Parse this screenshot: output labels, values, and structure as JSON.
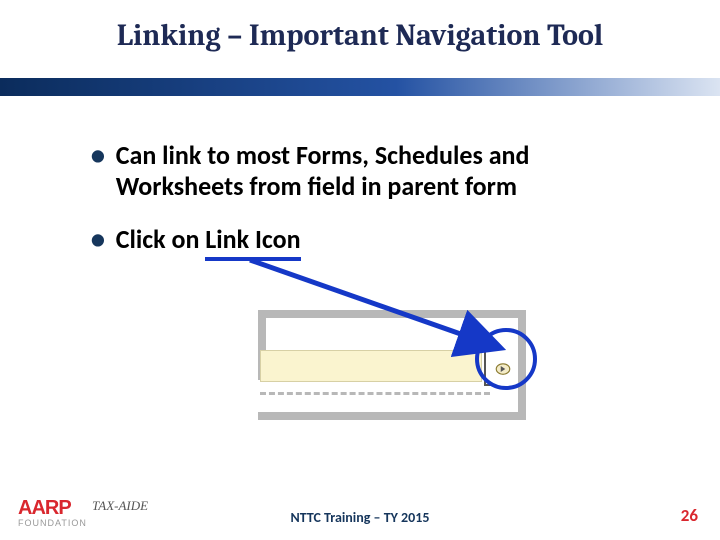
{
  "title": "Linking – Important Navigation Tool",
  "bullets": [
    "Can link to most Forms, Schedules and Worksheets from field in parent form",
    "Click on "
  ],
  "bullet2_linked": "Link Icon",
  "footer": {
    "org_logo": "AARP",
    "org_sub": "FOUNDATION",
    "program": "TAX-AIDE",
    "center": "NTTC Training – TY 2015",
    "page": "26"
  },
  "colors": {
    "title": "#1e2a55",
    "accent_blue": "#1538c7",
    "aarp_red": "#d9272e"
  }
}
